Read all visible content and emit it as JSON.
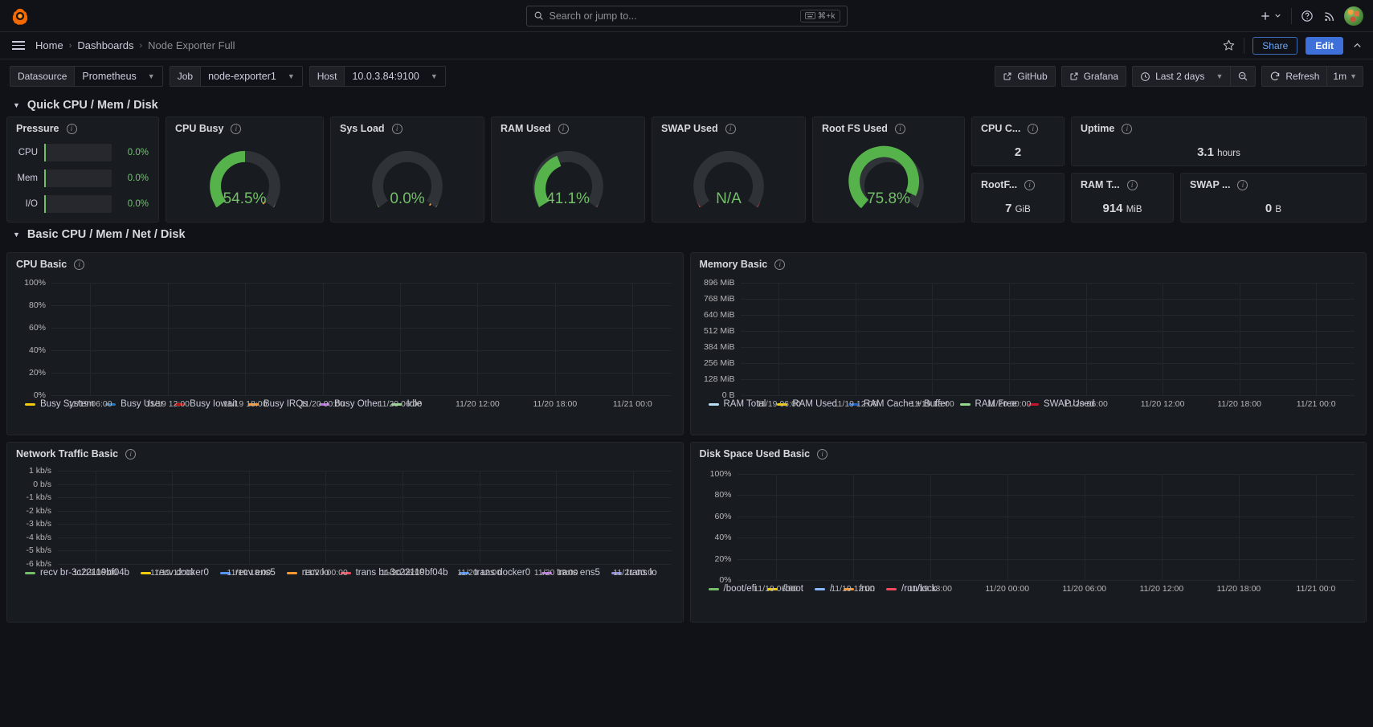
{
  "topbar": {
    "logo_icon": "grafana-logo-icon",
    "search_placeholder": "Search or jump to...",
    "search_kbd": "⌘+k",
    "keyboard_icon": "keyboard-icon",
    "plus_icon": "plus-icon",
    "help_icon": "help-circle-icon",
    "news_icon": "news-rss-icon",
    "avatar": "user-avatar"
  },
  "breadcrumb": {
    "menu_icon": "hamburger-menu-icon",
    "items": [
      {
        "label": "Home",
        "current": false
      },
      {
        "label": "Dashboards",
        "current": false
      },
      {
        "label": "Node Exporter Full",
        "current": true
      }
    ],
    "separator": "›",
    "star_icon": "star-outline-icon",
    "share_label": "Share",
    "edit_label": "Edit",
    "collapse_icon": "chevron-up-icon"
  },
  "variables": [
    {
      "name": "datasource",
      "label": "Datasource",
      "value": "Prometheus"
    },
    {
      "name": "job",
      "label": "Job",
      "value": "node-exporter1"
    },
    {
      "name": "host",
      "label": "Host",
      "value": "10.0.3.84:9100"
    }
  ],
  "toolbar": {
    "github_label": "GitHub",
    "github_icon": "external-link-icon",
    "grafana_label": "Grafana",
    "grafana_icon": "external-link-icon",
    "time_range": "Last 2 days",
    "clock_icon": "clock-icon",
    "zoom_out_icon": "zoom-out-icon",
    "refresh_label": "Refresh",
    "refresh_icon": "refresh-icon",
    "refresh_interval": "1m"
  },
  "rows": [
    {
      "name": "quick-cpu-mem-disk",
      "title": "Quick CPU / Mem / Disk",
      "expanded": true
    },
    {
      "name": "basic-cpu-mem-net-disk",
      "title": "Basic CPU / Mem / Net / Disk",
      "expanded": true
    }
  ],
  "stat_panels": {
    "pressure": {
      "title": "Pressure",
      "rows": [
        {
          "label": "CPU",
          "value": "0.0%",
          "pct": 0.0
        },
        {
          "label": "Mem",
          "value": "0.0%",
          "pct": 0.0
        },
        {
          "label": "I/O",
          "value": "0.0%",
          "pct": 0.0
        }
      ]
    },
    "gauges": [
      {
        "name": "cpu-busy",
        "title": "CPU Busy",
        "value": "54.5%",
        "pct": 54.5,
        "color": "#73bf69"
      },
      {
        "name": "sys-load",
        "title": "Sys Load",
        "value": "0.0%",
        "pct": 0.0,
        "color": "#73bf69"
      },
      {
        "name": "ram-used",
        "title": "RAM Used",
        "value": "41.1%",
        "pct": 41.1,
        "color": "#73bf69"
      },
      {
        "name": "swap-used",
        "title": "SWAP Used",
        "value": "N/A",
        "pct": 0.0,
        "color": "#73bf69"
      },
      {
        "name": "root-fs-used",
        "title": "Root FS Used",
        "value": "75.8%",
        "pct": 75.8,
        "color": "#73bf69"
      }
    ],
    "small": [
      {
        "name": "cpu-cores",
        "title": "CPU C...",
        "value": "2",
        "unit": ""
      },
      {
        "name": "uptime",
        "title": "Uptime",
        "value": "3.1",
        "unit": "hours"
      },
      {
        "name": "rootfs-total",
        "title": "RootF...",
        "value": "7",
        "unit": "GiB"
      },
      {
        "name": "ram-total",
        "title": "RAM T...",
        "value": "914",
        "unit": "MiB"
      },
      {
        "name": "swap-total",
        "title": "SWAP ...",
        "value": "0",
        "unit": "B"
      }
    ]
  },
  "chart_data": [
    {
      "name": "cpu-basic",
      "type": "line",
      "title": "CPU Basic",
      "ylabel": "",
      "xlabel": "",
      "ylim": [
        0,
        100
      ],
      "yticks": [
        "0%",
        "20%",
        "40%",
        "60%",
        "80%",
        "100%"
      ],
      "xticks": [
        "11/19 06:00",
        "11/19 12:00",
        "11/19 18:00",
        "11/20 00:00",
        "11/20 06:00",
        "11/20 12:00",
        "11/20 18:00",
        "11/21 00:0"
      ],
      "grid": true,
      "legend_position": "bottom",
      "series": [
        {
          "name": "Busy System",
          "color": "#f2cc0c",
          "values": []
        },
        {
          "name": "Busy User",
          "color": "#1f78c1",
          "values": []
        },
        {
          "name": "Busy Iowait",
          "color": "#b81414",
          "values": []
        },
        {
          "name": "Busy IRQs",
          "color": "#ff9830",
          "values": []
        },
        {
          "name": "Busy Other",
          "color": "#b877d9",
          "values": []
        },
        {
          "name": "Idle",
          "color": "#96d98d",
          "values": []
        }
      ]
    },
    {
      "name": "memory-basic",
      "type": "line",
      "title": "Memory Basic",
      "ylabel": "",
      "xlabel": "",
      "ylim": [
        0,
        896
      ],
      "yticks": [
        "0 B",
        "128 MiB",
        "256 MiB",
        "384 MiB",
        "512 MiB",
        "640 MiB",
        "768 MiB",
        "896 MiB"
      ],
      "xticks": [
        "11/19 06:00",
        "11/19 12:00",
        "11/19 18:00",
        "11/20 00:00",
        "11/20 06:00",
        "11/20 12:00",
        "11/20 18:00",
        "11/21 00:0"
      ],
      "grid": true,
      "legend_position": "bottom",
      "series": [
        {
          "name": "RAM Total",
          "color": "#badff4",
          "values": []
        },
        {
          "name": "RAM Used",
          "color": "#f2cc0c",
          "values": []
        },
        {
          "name": "RAM Cache + Buffer",
          "color": "#1f60c4",
          "values": []
        },
        {
          "name": "RAM Free",
          "color": "#96d98d",
          "values": []
        },
        {
          "name": "SWAP Used",
          "color": "#c4162a",
          "values": []
        }
      ]
    },
    {
      "name": "network-traffic-basic",
      "type": "line",
      "title": "Network Traffic Basic",
      "ylabel": "",
      "xlabel": "",
      "ylim": [
        -6,
        1
      ],
      "yticks": [
        "-6 kb/s",
        "-5 kb/s",
        "-4 kb/s",
        "-3 kb/s",
        "-2 kb/s",
        "-1 kb/s",
        "0 b/s",
        "1 kb/s"
      ],
      "xticks": [
        "11/19 06:00",
        "11/19 12:00",
        "11/19 18:00",
        "11/20 00:00",
        "11/20 06:00",
        "11/20 12:00",
        "11/20 18:00",
        "11/21 00:0"
      ],
      "grid": true,
      "legend_position": "bottom",
      "series": [
        {
          "name": "recv br-3c22119bf04b",
          "color": "#73bf69",
          "values": []
        },
        {
          "name": "recv docker0",
          "color": "#f2cc0c",
          "values": []
        },
        {
          "name": "recv ens5",
          "color": "#5794f2",
          "values": []
        },
        {
          "name": "recv lo",
          "color": "#ff9830",
          "values": []
        },
        {
          "name": "trans br-3c22119bf04b",
          "color": "#f2495c",
          "values": []
        },
        {
          "name": "trans docker0",
          "color": "#5794f2",
          "values": []
        },
        {
          "name": "trans ens5",
          "color": "#b877d9",
          "values": []
        },
        {
          "name": "trans lo",
          "color": "#8f8fd9",
          "values": []
        }
      ]
    },
    {
      "name": "disk-space-used-basic",
      "type": "line",
      "title": "Disk Space Used Basic",
      "ylabel": "",
      "xlabel": "",
      "ylim": [
        0,
        100
      ],
      "yticks": [
        "0%",
        "20%",
        "40%",
        "60%",
        "80%",
        "100%"
      ],
      "xticks": [
        "11/19 06:00",
        "11/19 12:00",
        "11/19 18:00",
        "11/20 00:00",
        "11/20 06:00",
        "11/20 12:00",
        "11/20 18:00",
        "11/21 00:0"
      ],
      "grid": true,
      "legend_position": "bottom",
      "series": [
        {
          "name": "/boot/efi",
          "color": "#73bf69",
          "values": []
        },
        {
          "name": "/boot",
          "color": "#f2cc0c",
          "values": []
        },
        {
          "name": "/",
          "color": "#8ab8ff",
          "values": []
        },
        {
          "name": "/run",
          "color": "#ff9830",
          "values": []
        },
        {
          "name": "/run/lock",
          "color": "#f2495c",
          "values": []
        }
      ]
    }
  ]
}
